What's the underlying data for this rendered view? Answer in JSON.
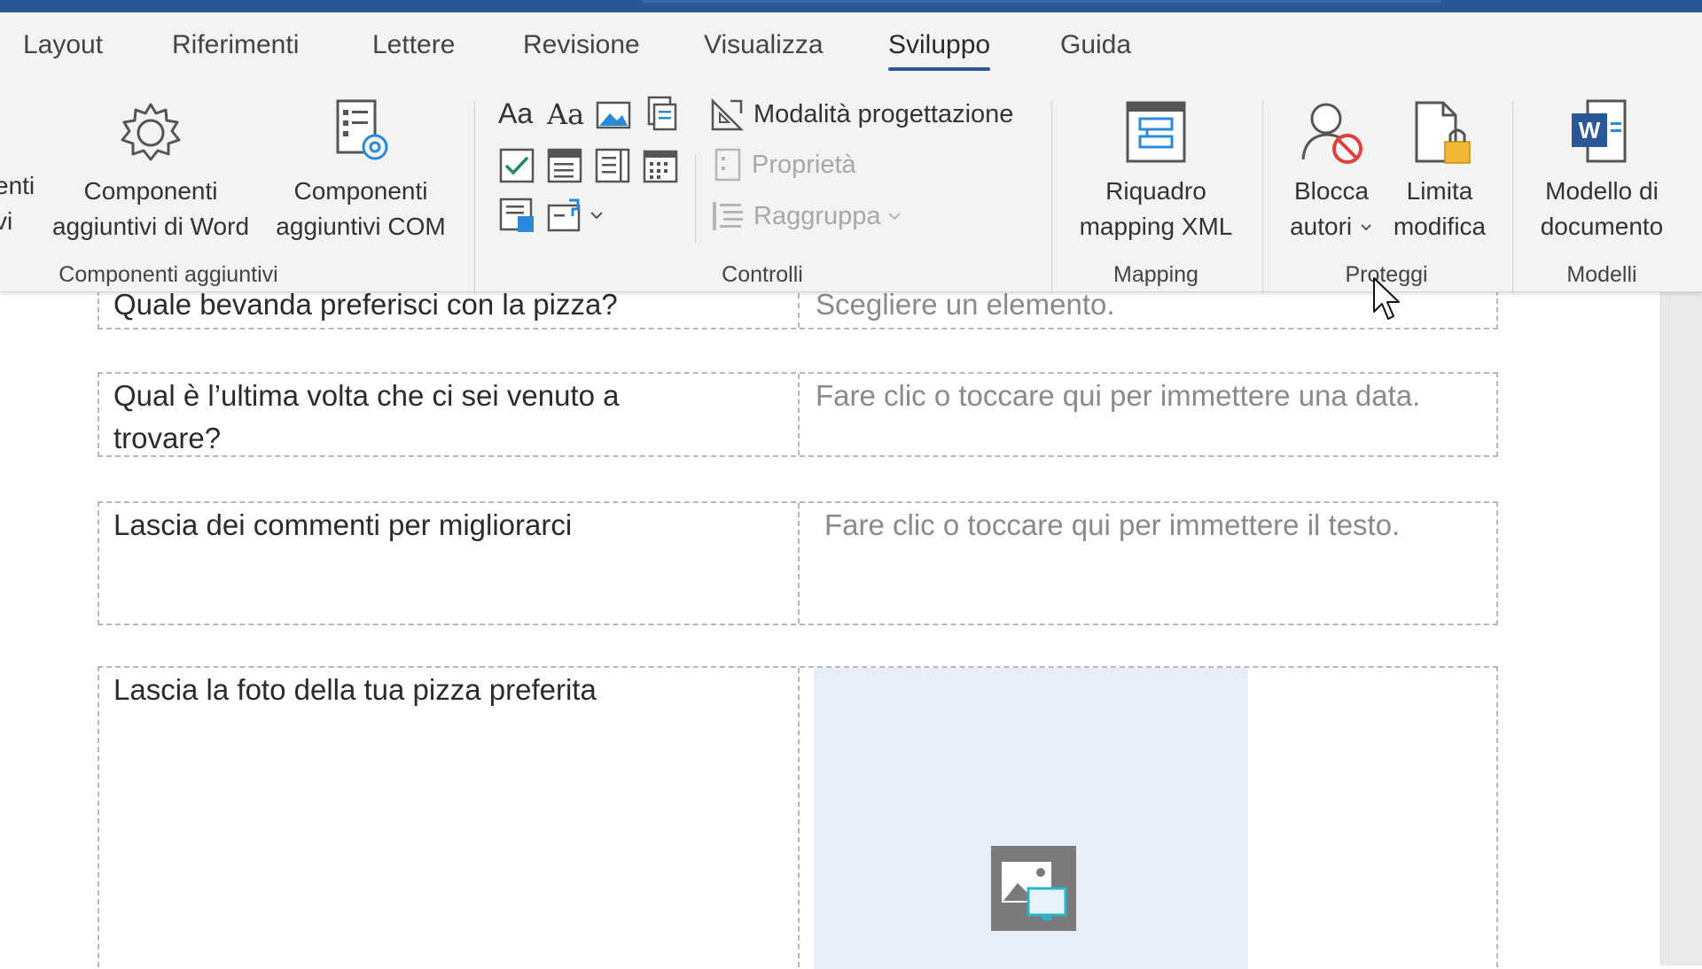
{
  "tabs": [
    "Layout",
    "Riferimenti",
    "Lettere",
    "Revisione",
    "Visualizza",
    "Sviluppo",
    "Guida"
  ],
  "active_tab": "Sviluppo",
  "ribbon": {
    "partial_left": {
      "line1": "enti",
      "line2": "vi"
    },
    "addins": {
      "word_line1": "Componenti",
      "word_line2": "aggiuntivi di Word",
      "com_line1": "Componenti",
      "com_line2": "aggiuntivi COM",
      "group_label": "Componenti aggiuntivi"
    },
    "controls": {
      "design_mode": "Modalità progettazione",
      "properties": "Proprietà",
      "group": "Raggruppa",
      "group_label": "Controlli"
    },
    "mapping": {
      "xml_line1": "Riquadro",
      "xml_line2": "mapping XML",
      "group_label": "Mapping"
    },
    "protect": {
      "block_line1": "Blocca",
      "block_line2": "autori",
      "limit_line1": "Limita",
      "limit_line2": "modifica",
      "group_label": "Proteggi"
    },
    "templates": {
      "doc_line1": "Modello di",
      "doc_line2": "documento",
      "group_label": "Modelli"
    }
  },
  "document": {
    "rows": [
      {
        "question": "Quale bevanda preferisci con la pizza?",
        "answer": "Scegliere un elemento."
      },
      {
        "question_line1": "Qual è l’ultima volta che ci sei venuto a",
        "question_line2": "trovare?",
        "answer": "Fare clic o toccare qui per immettere una data."
      },
      {
        "question": "Lascia dei commenti per migliorarci",
        "answer": "Fare clic o toccare qui per immettere il testo."
      },
      {
        "question": "Lascia la foto della tua pizza preferita"
      }
    ]
  },
  "colors": {
    "accent": "#2b579a",
    "ribbon_bg": "#f3f3f3",
    "placeholder_fill": "#e7eef8"
  }
}
